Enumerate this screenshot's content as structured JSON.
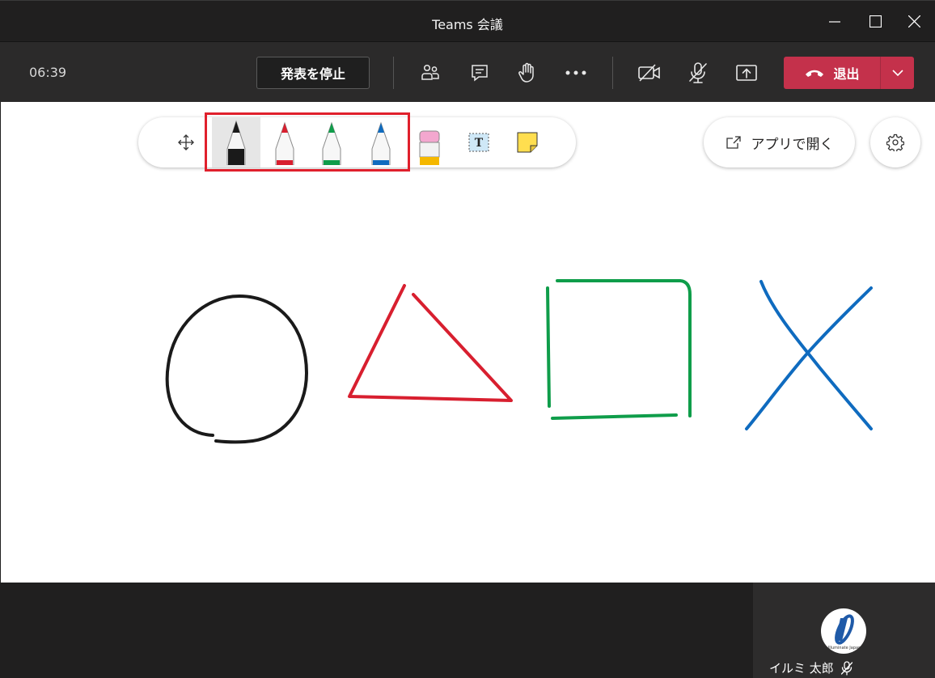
{
  "window": {
    "title": "Teams 会議"
  },
  "toolbar": {
    "timer": "06:39",
    "stop_presenting_label": "発表を停止",
    "leave_label": "退出",
    "icons": [
      "participants-icon",
      "chat-icon",
      "raise-hand-icon",
      "more-options-icon",
      "camera-off-icon",
      "mic-off-icon",
      "share-screen-icon"
    ],
    "leave_color": "#c4314b"
  },
  "whiteboard": {
    "tools": [
      "move-tool",
      "black-pen",
      "red-pen",
      "green-pen",
      "blue-pen",
      "eraser",
      "text-tool",
      "sticky-note"
    ],
    "selected_tool": "black-pen",
    "pen_colors": {
      "black": "#1a1a1a",
      "red": "#d81f2f",
      "green": "#0f9d4a",
      "blue": "#0f6bbf"
    },
    "highlight_color": "#e0202c",
    "open_app_label": "アプリで開く"
  },
  "participant": {
    "name": "イルミ 太郎",
    "muted": true
  }
}
